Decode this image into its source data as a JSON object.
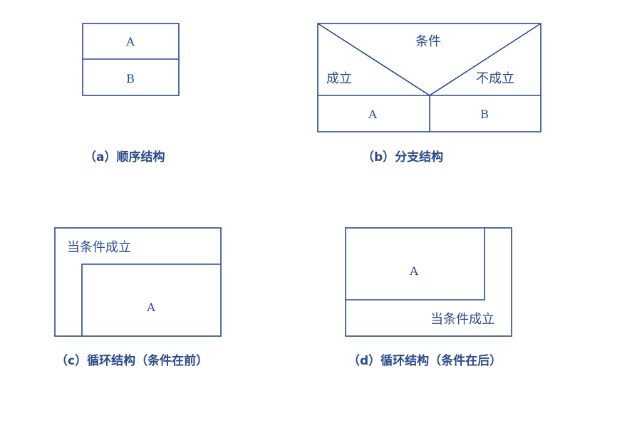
{
  "diagram_a": {
    "box_top_label": "A",
    "box_bottom_label": "B",
    "caption": "（a）顺序结构"
  },
  "diagram_b": {
    "condition_label": "条件",
    "true_label": "成立",
    "false_label": "不成立",
    "left_box_label": "A",
    "right_box_label": "B",
    "caption": "（b）分支结构"
  },
  "diagram_c": {
    "condition_label": "当条件成立",
    "body_label": "A",
    "caption": "（c）循环结构（条件在前）"
  },
  "diagram_d": {
    "body_label": "A",
    "condition_label": "当条件成立",
    "caption": "（d）循环结构（条件在后）"
  },
  "colors": {
    "line": "#2a4a8c",
    "text": "#2a4a8c",
    "background": "#ffffff"
  }
}
